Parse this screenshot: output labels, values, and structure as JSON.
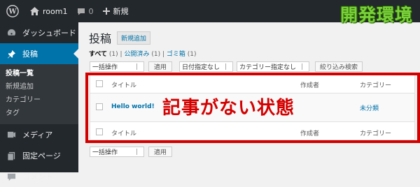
{
  "admin_bar": {
    "site_name": "room1",
    "comments_count": "0",
    "new_label": "新規",
    "env_label": "開発環境"
  },
  "sidebar": {
    "items": [
      {
        "label": "ダッシュボード",
        "icon": "dashboard-icon"
      },
      {
        "label": "投稿",
        "icon": "pin-icon",
        "current": true
      },
      {
        "label": "メディア",
        "icon": "media-icon"
      },
      {
        "label": "固定ページ",
        "icon": "page-icon"
      },
      {
        "label": "コメント",
        "icon": "comment-icon"
      }
    ],
    "submenu": [
      "投稿一覧",
      "新規追加",
      "カテゴリー",
      "タグ"
    ]
  },
  "main": {
    "title": "投稿",
    "add_new": "新規追加",
    "filters": {
      "all": "すべて",
      "all_count": "(1)",
      "sep1": "|",
      "published": "公開済み",
      "published_count": "(1)",
      "sep2": "|",
      "trash": "ゴミ箱",
      "trash_count": "(1)"
    },
    "bulk_actions": "一括操作",
    "apply": "適用",
    "date_filter": "日付指定なし",
    "category_filter": "カテゴリー指定なし",
    "filter_button": "絞り込み検索",
    "table": {
      "col_title": "タイトル",
      "col_author": "作成者",
      "col_category": "カテゴリー",
      "row_title": "Hello world!",
      "row_category": "未分類"
    },
    "overlay_text": "記事がない状態"
  }
}
